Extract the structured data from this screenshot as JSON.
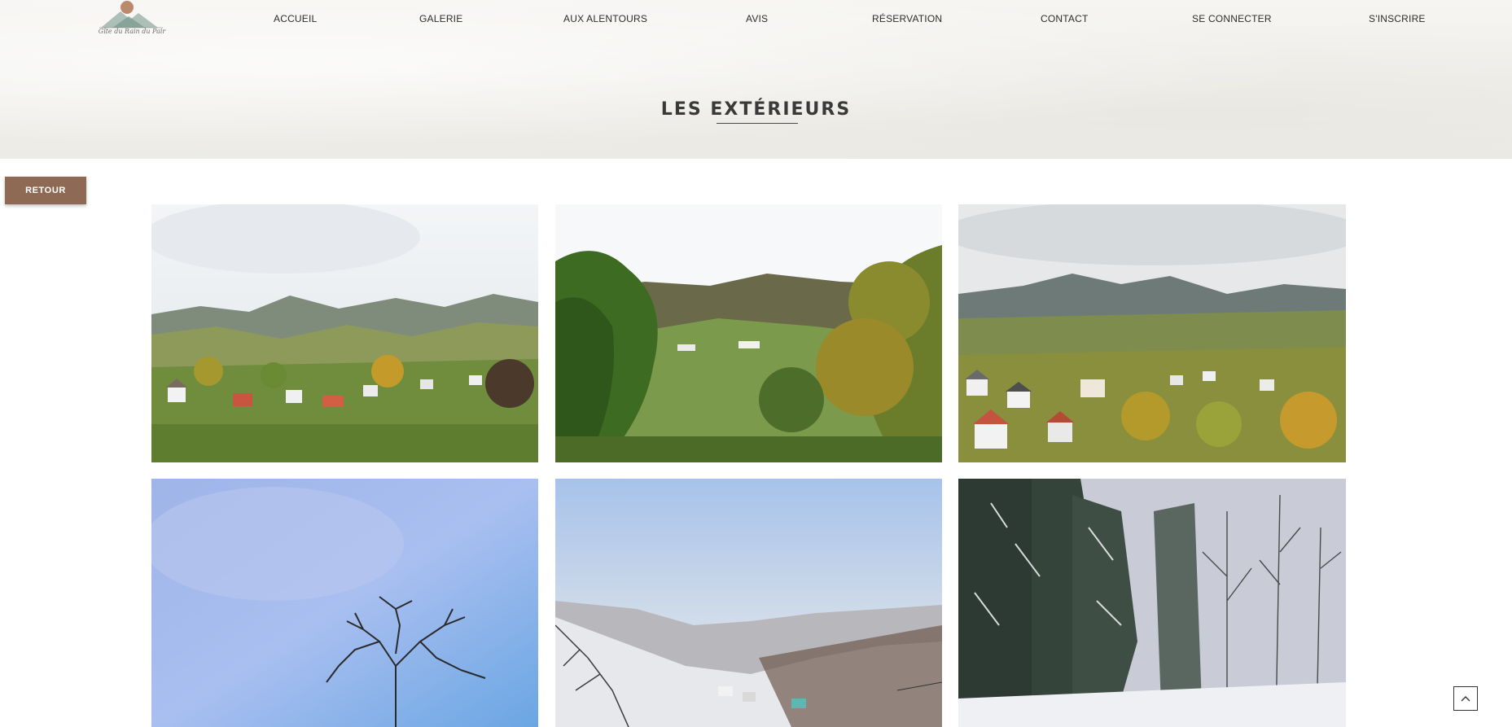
{
  "brand": {
    "logo_text": "Gîte du Rain du Pair",
    "logo_icon": "mountain-sun-icon"
  },
  "nav": {
    "items": [
      {
        "label": "ACCUEIL"
      },
      {
        "label": "GALERIE"
      },
      {
        "label": "AUX ALENTOURS"
      },
      {
        "label": "AVIS"
      },
      {
        "label": "RÉSERVATION"
      },
      {
        "label": "CONTACT"
      },
      {
        "label": "SE CONNECTER"
      },
      {
        "label": "S'INSCRIRE"
      }
    ]
  },
  "page": {
    "title": "LES EXTÉRIEURS"
  },
  "actions": {
    "back_label": "RETOUR",
    "to_top_icon": "chevron-up-icon"
  },
  "colors": {
    "accent": "#8e6a54",
    "hero_bg": "#f2f1ed"
  }
}
